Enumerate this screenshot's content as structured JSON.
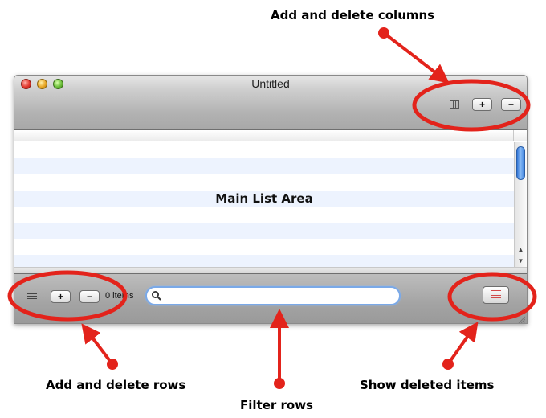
{
  "callouts": {
    "columns": "Add and delete columns",
    "rows": "Add and delete rows",
    "filter": "Filter rows",
    "deleted": "Show deleted items"
  },
  "window": {
    "title": "Untitled",
    "traffic_lights": [
      "close",
      "minimize",
      "zoom"
    ]
  },
  "toolbar": {
    "columns_icon": "columns-icon",
    "add_label": "+",
    "remove_label": "−"
  },
  "list": {
    "label": "Main List Area"
  },
  "bottombar": {
    "rows_icon": "list-rows-icon",
    "add_label": "+",
    "remove_label": "−",
    "count_label": "0 items",
    "search_icon": "magnifier-icon",
    "filter_value": "",
    "trash_icon": "deleted-items-icon"
  },
  "colors": {
    "annotation": "#e3231b",
    "row_stripe": "#edf3fe",
    "filter_focus": "#7aa9e8"
  }
}
